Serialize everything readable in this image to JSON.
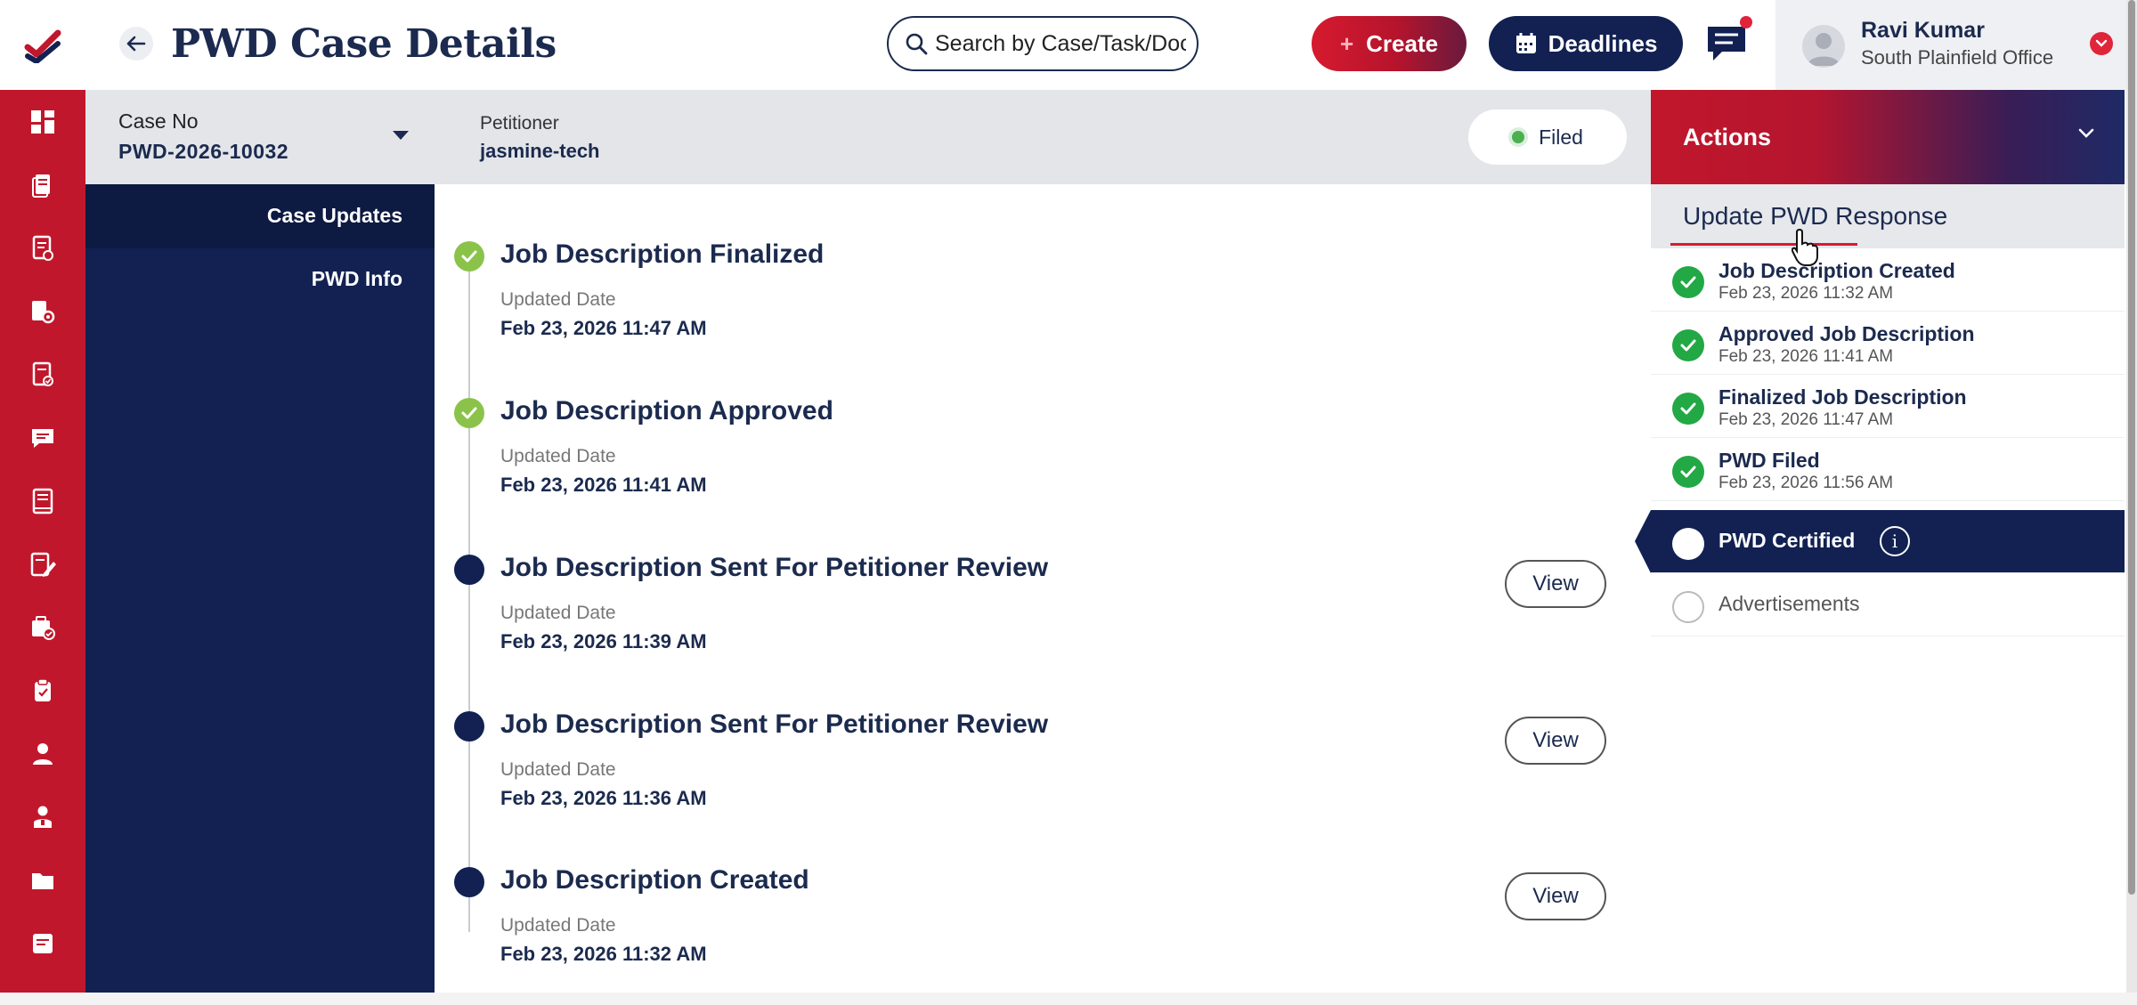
{
  "header": {
    "title": "PWD Case Details",
    "search_placeholder": "Search by Case/Task/Docu",
    "create_label": "Create",
    "deadlines_label": "Deadlines"
  },
  "user": {
    "name": "Ravi Kumar",
    "office": "South Plainfield Office"
  },
  "case": {
    "case_no_label": "Case No",
    "case_no": "PWD-2026-10032",
    "petitioner_label": "Petitioner",
    "petitioner": "jasmine-tech",
    "status": "Filed"
  },
  "subnav": {
    "items": [
      {
        "label": "Case Updates"
      },
      {
        "label": "PWD Info"
      }
    ]
  },
  "timeline": {
    "date_label": "Updated Date",
    "view_label": "View",
    "items": [
      {
        "title": "Job Description Finalized",
        "date": "Feb 23, 2026 11:47 AM",
        "state": "done"
      },
      {
        "title": "Job Description Approved",
        "date": "Feb 23, 2026 11:41 AM",
        "state": "done"
      },
      {
        "title": "Job Description Sent For Petitioner Review",
        "date": "Feb 23, 2026 11:39 AM",
        "state": "pending"
      },
      {
        "title": "Job Description Sent For Petitioner Review",
        "date": "Feb 23, 2026 11:36 AM",
        "state": "pending"
      },
      {
        "title": "Job Description Created",
        "date": "Feb 23, 2026 11:32 AM",
        "state": "pending"
      }
    ]
  },
  "actions": {
    "title": "Actions",
    "update_label": "Update PWD Response",
    "steps": [
      {
        "name": "Job Description Created",
        "date": "Feb 23, 2026 11:32 AM",
        "state": "done"
      },
      {
        "name": "Approved Job Description",
        "date": "Feb 23, 2026 11:41 AM",
        "state": "done"
      },
      {
        "name": "Finalized Job Description",
        "date": "Feb 23, 2026 11:47 AM",
        "state": "done"
      },
      {
        "name": "PWD Filed",
        "date": "Feb 23, 2026 11:56 AM",
        "state": "done"
      },
      {
        "name": "PWD Certified",
        "state": "current"
      },
      {
        "name": "Advertisements",
        "state": "todo"
      }
    ]
  },
  "rail": {
    "icons": [
      "dashboard-icon",
      "documents-icon",
      "case-list-icon",
      "case-settings-icon",
      "approved-docs-icon",
      "messages-icon",
      "book-icon",
      "edit-form-icon",
      "case-approved-icon",
      "clipboard-icon",
      "user-icon",
      "contact-icon",
      "folder-icon",
      "notes-icon"
    ]
  },
  "colors": {
    "brand_red": "#c1172c",
    "navy": "#122152",
    "done_green": "#22a844",
    "timeline_done": "#8bc34a"
  }
}
